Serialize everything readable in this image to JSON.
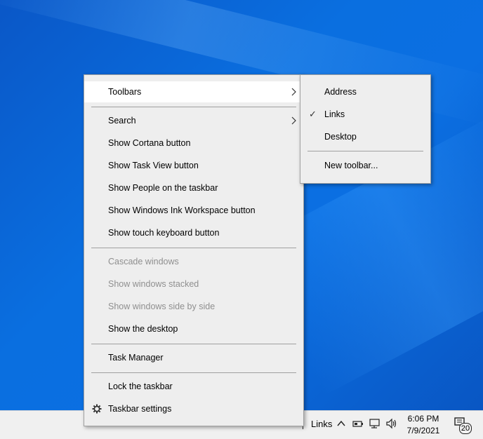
{
  "context_menu": {
    "items": [
      {
        "label": "Toolbars"
      },
      {
        "label": "Search"
      },
      {
        "label": "Show Cortana button"
      },
      {
        "label": "Show Task View button"
      },
      {
        "label": "Show People on the taskbar"
      },
      {
        "label": "Show Windows Ink Workspace button"
      },
      {
        "label": "Show touch keyboard button"
      },
      {
        "label": "Cascade windows"
      },
      {
        "label": "Show windows stacked"
      },
      {
        "label": "Show windows side by side"
      },
      {
        "label": "Show the desktop"
      },
      {
        "label": "Task Manager"
      },
      {
        "label": "Lock the taskbar"
      },
      {
        "label": "Taskbar settings"
      }
    ],
    "submenu_arrow": "›"
  },
  "toolbars_submenu": {
    "items": [
      {
        "label": "Address",
        "checked": false
      },
      {
        "label": "Links",
        "checked": true
      },
      {
        "label": "Desktop",
        "checked": false
      },
      {
        "label": "New toolbar..."
      }
    ],
    "check_glyph": "✓"
  },
  "taskbar": {
    "toolbar_label": "Links",
    "time": "6:06 PM",
    "date": "7/9/2021",
    "notification_count": "20",
    "icons": [
      "chevron-up-icon",
      "battery-icon",
      "network-icon",
      "volume-icon",
      "action-center-icon"
    ]
  }
}
